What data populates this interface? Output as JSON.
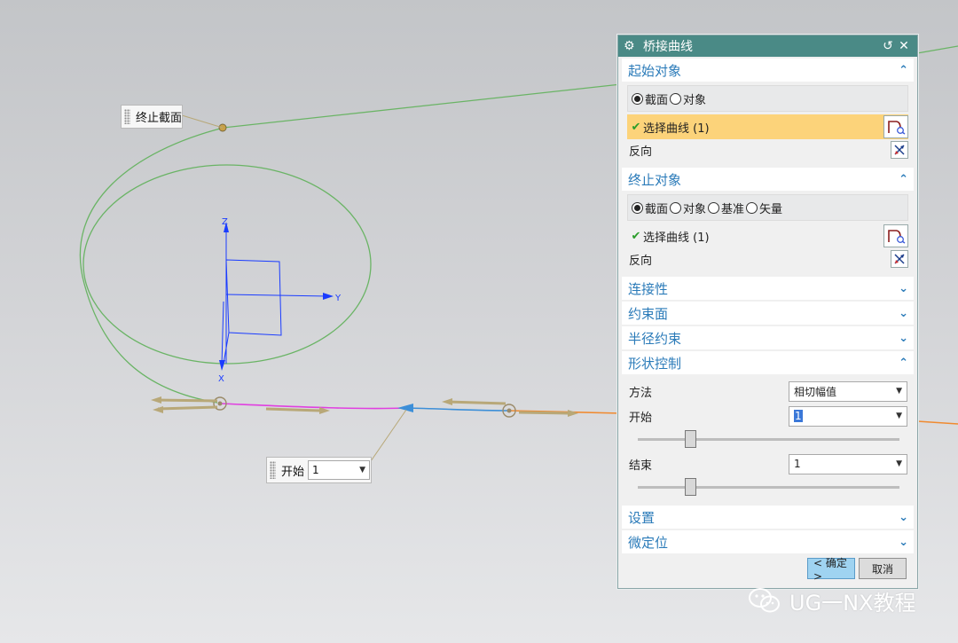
{
  "viewport": {
    "axes": {
      "z_label": "Z",
      "y_label": "Y",
      "x_label": "X"
    },
    "end_callout": {
      "label": "终止截面"
    },
    "start_callout": {
      "label": "开始",
      "value": "1"
    },
    "colors": {
      "background_top": "#c3c5c8",
      "green_curve": "#6ab465",
      "magenta_curve": "#e040e0",
      "blue_curve": "#3c8fd8",
      "orange_curve": "#f08a30",
      "axis_blue": "#1a3cff",
      "arrow_tan": "#b8a878"
    }
  },
  "dialog": {
    "title": "桥接曲线",
    "icons": {
      "settings": "gear-icon",
      "reset": "reset-icon",
      "close": "close-icon"
    },
    "start_object": {
      "header": "起始对象",
      "radio_section": "截面",
      "radio_object": "对象",
      "select_curve": "选择曲线 (1)",
      "reverse": "反向"
    },
    "end_object": {
      "header": "终止对象",
      "radio_section": "截面",
      "radio_object": "对象",
      "radio_datum": "基准",
      "radio_vector": "矢量",
      "select_curve": "选择曲线 (1)",
      "reverse": "反向"
    },
    "connectivity": {
      "header": "连接性"
    },
    "constraint_face": {
      "header": "约束面"
    },
    "radius_constraint": {
      "header": "半径约束"
    },
    "shape_control": {
      "header": "形状控制",
      "method_label": "方法",
      "method_value": "相切幅值",
      "start_label": "开始",
      "start_value": "1",
      "start_slider_fraction": 0.2,
      "end_label": "结束",
      "end_value": "1",
      "end_slider_fraction": 0.2
    },
    "settings": {
      "header": "设置"
    },
    "fine_position": {
      "header": "微定位"
    },
    "ok_button": "< 确定 >",
    "cancel_button": "取消",
    "accent_color": "#2b7bb9",
    "titlebar_color": "#4a8a86",
    "active_row_color": "#fcd37a"
  },
  "watermark": {
    "text": "UG一NX教程"
  }
}
